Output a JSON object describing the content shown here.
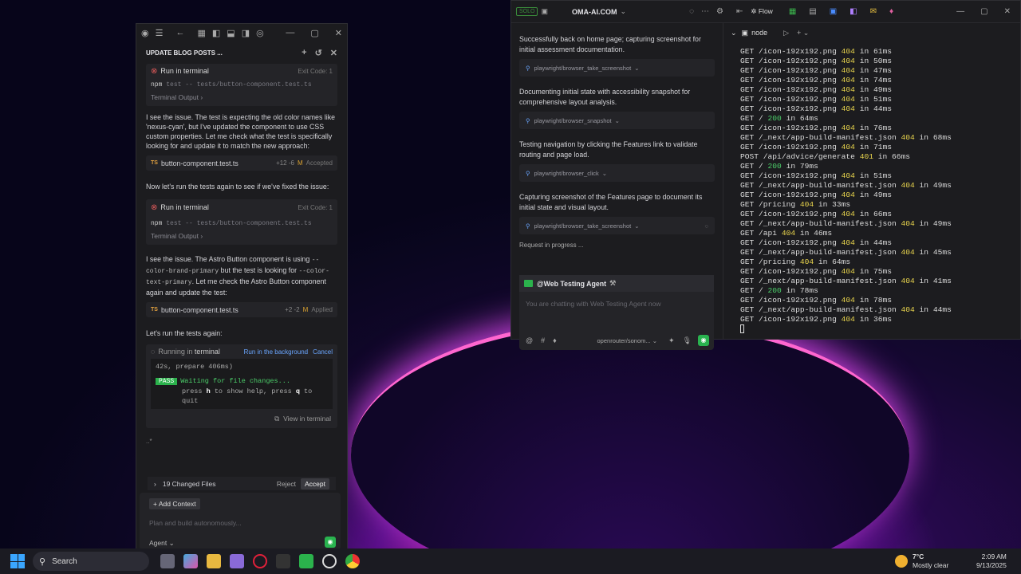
{
  "left": {
    "header": "UPDATE BLOG POSTS ...",
    "t1": {
      "label": "Run in terminal",
      "exit": "Exit Code: 1",
      "cmd": "npm",
      "args": "test -- tests/button-component.test.ts",
      "out": "Terminal Output ›"
    },
    "msg1": "I see the issue. The test is expecting the old color names like 'nexus-cyan', but I've updated the component to use CSS custom properties. Let me check what the test is specifically looking for and update it to match the new approach:",
    "f1": {
      "ts": "TS",
      "name": "button-component.test.ts",
      "diff": "+12 -6",
      "m": "M",
      "status": "Accepted"
    },
    "msg2": "Now let's run the tests again to see if we've fixed the issue:",
    "t2": {
      "label": "Run in terminal",
      "exit": "Exit Code: 1",
      "cmd": "npm",
      "args": "test -- tests/button-component.test.ts",
      "out": "Terminal Output ›"
    },
    "msg3a": "I see the issue. The Astro Button component is using",
    "msg3code1": "--color-brand-primary",
    "msg3b": "but the test is looking for",
    "msg3code2": "--color-text-primary",
    "msg3c": ". Let me check the Astro Button component again and update the test:",
    "f2": {
      "ts": "TS",
      "name": "button-component.test.ts",
      "diff": "+2 -2",
      "m": "M",
      "status": "Applied"
    },
    "msg4": "Let's run the tests again:",
    "run": {
      "label_a": "Running in",
      "label_b": "terminal",
      "bg": "Run in the background",
      "cancel": "Cancel",
      "line1": "42s, prepare 406ms)",
      "pass": "PASS",
      "line2": "Waiting for file changes...",
      "line3a": "press ",
      "h": "h",
      "line3b": " to show help, press ",
      "q": "q",
      "line3c": " to quit",
      "view": "View in terminal"
    },
    "dots": "..*",
    "changed": {
      "label": "19 Changed Files",
      "reject": "Reject",
      "accept": "Accept"
    },
    "composer": {
      "add": "Add Context",
      "placeholder": "Plan and build autonomously...",
      "agent": "Agent"
    }
  },
  "right": {
    "solo": "SOLO",
    "brand": "OMA-AI.COM",
    "flow": "Flow",
    "node_tab": "node",
    "msgs": [
      {
        "text": "Successfully back on home page; capturing screenshot for initial assessment documentation.",
        "tool": "playwright/browser_take_screenshot"
      },
      {
        "text": "Documenting initial state with accessibility snapshot for comprehensive layout analysis.",
        "tool": "playwright/browser_snapshot"
      },
      {
        "text": "Testing navigation by clicking the Features link to validate routing and page load.",
        "tool": "playwright/browser_click"
      },
      {
        "text": "Capturing screenshot of the Features page to document its initial state and visual layout.",
        "tool": "playwright/browser_take_screenshot"
      }
    ],
    "progress": "Request in progress ...",
    "agent": {
      "name": "@Web Testing Agent",
      "placeholder": "You are chatting with Web Testing Agent now",
      "model": "openrouter/sonom..."
    },
    "log": [
      [
        "GET /icon-192x192.png ",
        "404",
        " in 61ms"
      ],
      [
        "GET /icon-192x192.png ",
        "404",
        " in 50ms"
      ],
      [
        "GET /icon-192x192.png ",
        "404",
        " in 47ms"
      ],
      [
        "GET /icon-192x192.png ",
        "404",
        " in 74ms"
      ],
      [
        "GET /icon-192x192.png ",
        "404",
        " in 49ms"
      ],
      [
        "GET /icon-192x192.png ",
        "404",
        " in 51ms"
      ],
      [
        "GET /icon-192x192.png ",
        "404",
        " in 44ms"
      ],
      [
        "GET / ",
        "200",
        " in 64ms"
      ],
      [
        "GET /icon-192x192.png ",
        "404",
        " in 76ms"
      ],
      [
        "GET /_next/app-build-manifest.json ",
        "404",
        " in 68ms"
      ],
      [
        "GET /icon-192x192.png ",
        "404",
        " in 71ms"
      ],
      [
        "POST /api/advice/generate ",
        "401",
        " in 66ms"
      ],
      [
        "GET / ",
        "200",
        " in 79ms"
      ],
      [
        "GET /icon-192x192.png ",
        "404",
        " in 51ms"
      ],
      [
        "GET /_next/app-build-manifest.json ",
        "404",
        " in 49ms"
      ],
      [
        "GET /icon-192x192.png ",
        "404",
        " in 49ms"
      ],
      [
        "GET /pricing ",
        "404",
        " in 33ms"
      ],
      [
        "GET /icon-192x192.png ",
        "404",
        " in 66ms"
      ],
      [
        "GET /_next/app-build-manifest.json ",
        "404",
        " in 49ms"
      ],
      [
        "GET /api ",
        "404",
        " in 46ms"
      ],
      [
        "GET /icon-192x192.png ",
        "404",
        " in 44ms"
      ],
      [
        "GET /_next/app-build-manifest.json ",
        "404",
        " in 45ms"
      ],
      [
        "GET /pricing ",
        "404",
        " in 64ms"
      ],
      [
        "GET /icon-192x192.png ",
        "404",
        " in 75ms"
      ],
      [
        "GET /_next/app-build-manifest.json ",
        "404",
        " in 41ms"
      ],
      [
        "GET / ",
        "200",
        " in 78ms"
      ],
      [
        "GET /icon-192x192.png ",
        "404",
        " in 78ms"
      ],
      [
        "GET /_next/app-build-manifest.json ",
        "404",
        " in 44ms"
      ],
      [
        "GET /icon-192x192.png ",
        "404",
        " in 36ms"
      ]
    ]
  },
  "taskbar": {
    "search": "Search",
    "temp": "7°C",
    "weather": "Mostly clear",
    "time": "2:09 AM",
    "date": "9/13/2025"
  }
}
